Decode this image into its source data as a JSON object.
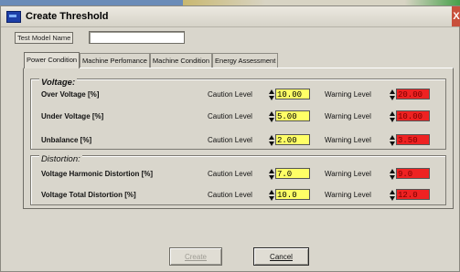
{
  "window": {
    "title": "Create Threshold",
    "close_glyph": "X"
  },
  "model": {
    "label": "Test Model Name",
    "value": ""
  },
  "tabs": [
    {
      "label": "Power Condition",
      "active": true
    },
    {
      "label": "Machine Perfomance",
      "active": false
    },
    {
      "label": "Machine Condition",
      "active": false
    },
    {
      "label": "Energy Assessment",
      "active": false
    }
  ],
  "voltage": {
    "title": "Voltage:",
    "rows": [
      {
        "name": "Over Voltage [%]",
        "caution_label": "Caution Level",
        "caution": "10.00",
        "warning_label": "Warning Level",
        "warning": "20.00"
      },
      {
        "name": "Under Voltage [%]",
        "caution_label": "Caution Level",
        "caution": "5.00",
        "warning_label": "Warning Level",
        "warning": "10.00"
      },
      {
        "name": "Unbalance [%]",
        "caution_label": "Caution Level",
        "caution": "2.00",
        "warning_label": "Warning Level",
        "warning": "3.50"
      }
    ]
  },
  "distortion": {
    "title": "Distortion:",
    "rows": [
      {
        "name": "Voltage Harmonic Distortion [%]",
        "caution_label": "Caution Level",
        "caution": "7.0",
        "warning_label": "Warning Level",
        "warning": "9.0"
      },
      {
        "name": "Voltage Total Distortion [%]",
        "caution_label": "Caution Level",
        "caution": "10.0",
        "warning_label": "Warning Level",
        "warning": "12.0"
      }
    ]
  },
  "buttons": {
    "create": "Create",
    "cancel": "Cancel"
  },
  "colors": {
    "caution_bg": "#ffff66",
    "warning_bg": "#ee2222",
    "title_icon": "#1d3fa8"
  }
}
